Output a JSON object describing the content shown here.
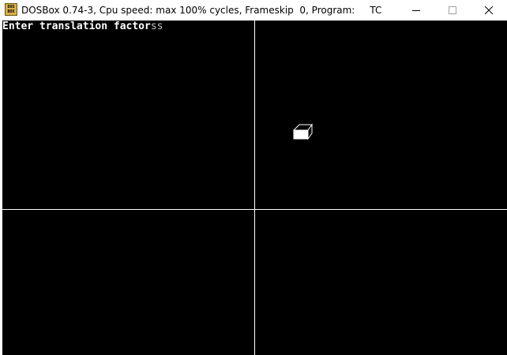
{
  "window": {
    "title": "DOSBox 0.74-3, Cpu speed: max 100% cycles, Frameskip  0, Program:     TC",
    "icon_label": "DOS BOX",
    "buttons": {
      "minimize_glyph": "—",
      "maximize_glyph": "☐",
      "close_glyph": "✕"
    }
  },
  "screen": {
    "prompt": "Enter translation factor",
    "typed_input": "ss",
    "background_color": "#000000",
    "foreground_color": "#ffffff"
  },
  "icons": {
    "app": "dosbox-icon",
    "cube": "cube-shape"
  }
}
